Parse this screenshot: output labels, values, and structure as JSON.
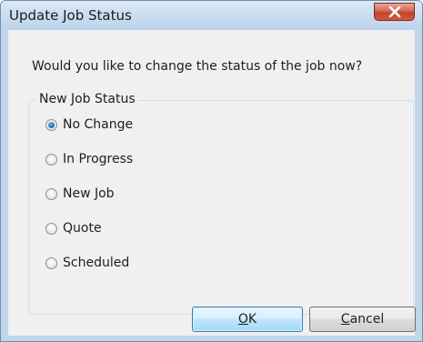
{
  "window": {
    "title": "Update Job Status",
    "close_icon": "close-x-icon"
  },
  "prompt": "Would you like to change the status of the job now?",
  "group": {
    "label": "New Job Status",
    "options": [
      {
        "label": "No Change",
        "checked": true
      },
      {
        "label": "In Progress",
        "checked": false
      },
      {
        "label": "New Job",
        "checked": false
      },
      {
        "label": "Quote",
        "checked": false
      },
      {
        "label": "Scheduled",
        "checked": false
      }
    ]
  },
  "buttons": {
    "ok": {
      "mnemonic": "O",
      "rest": "K"
    },
    "cancel": {
      "mnemonic": "C",
      "rest": "ancel"
    }
  },
  "colors": {
    "titlebar": "#c9dcf0",
    "close_button": "#c1432c",
    "client_background": "#f0f0f0",
    "default_button_border": "#3c7fb1"
  }
}
